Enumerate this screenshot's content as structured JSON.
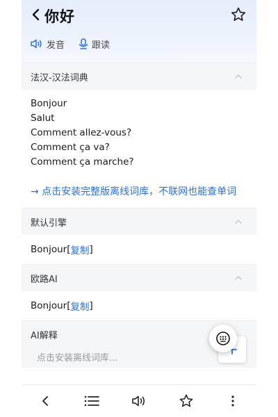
{
  "header": {
    "title": "你好",
    "pronounce_label": "发音",
    "follow_read_label": "跟读"
  },
  "dictionary": {
    "title": "法汉-汉法词典",
    "lines": [
      "Bonjour",
      "Salut",
      "Comment allez-vous?",
      "Comment ça va?",
      "Comment ça marche?"
    ],
    "install_link": "→ 点击安装完整版离线词库，不联网也能查单词"
  },
  "default_engine": {
    "title": "默认引擎",
    "result": "Bonjour",
    "copy_open": " [",
    "copy_label": "复制",
    "copy_close": "]"
  },
  "oulu_ai": {
    "title": "欧路AI",
    "result": "Bonjour",
    "copy_open": " [",
    "copy_label": "复制",
    "copy_close": "]"
  },
  "ai_explain": {
    "title": "AI解释",
    "placeholder": "点击安装离线词库..."
  },
  "icons": {
    "back": "chevron-left-icon",
    "star": "star-outline-icon",
    "speaker": "speaker-icon",
    "mic": "microphone-icon",
    "chevron_up": "chevron-up-icon",
    "close": "close-icon",
    "plus": "plus-icon",
    "keyboard": "keyboard-icon",
    "list": "list-icon",
    "more": "more-vertical-icon"
  },
  "colors": {
    "accent": "#2b6fd6",
    "header_bg": "#e6edfb",
    "section_bg": "#f5f6f7"
  }
}
